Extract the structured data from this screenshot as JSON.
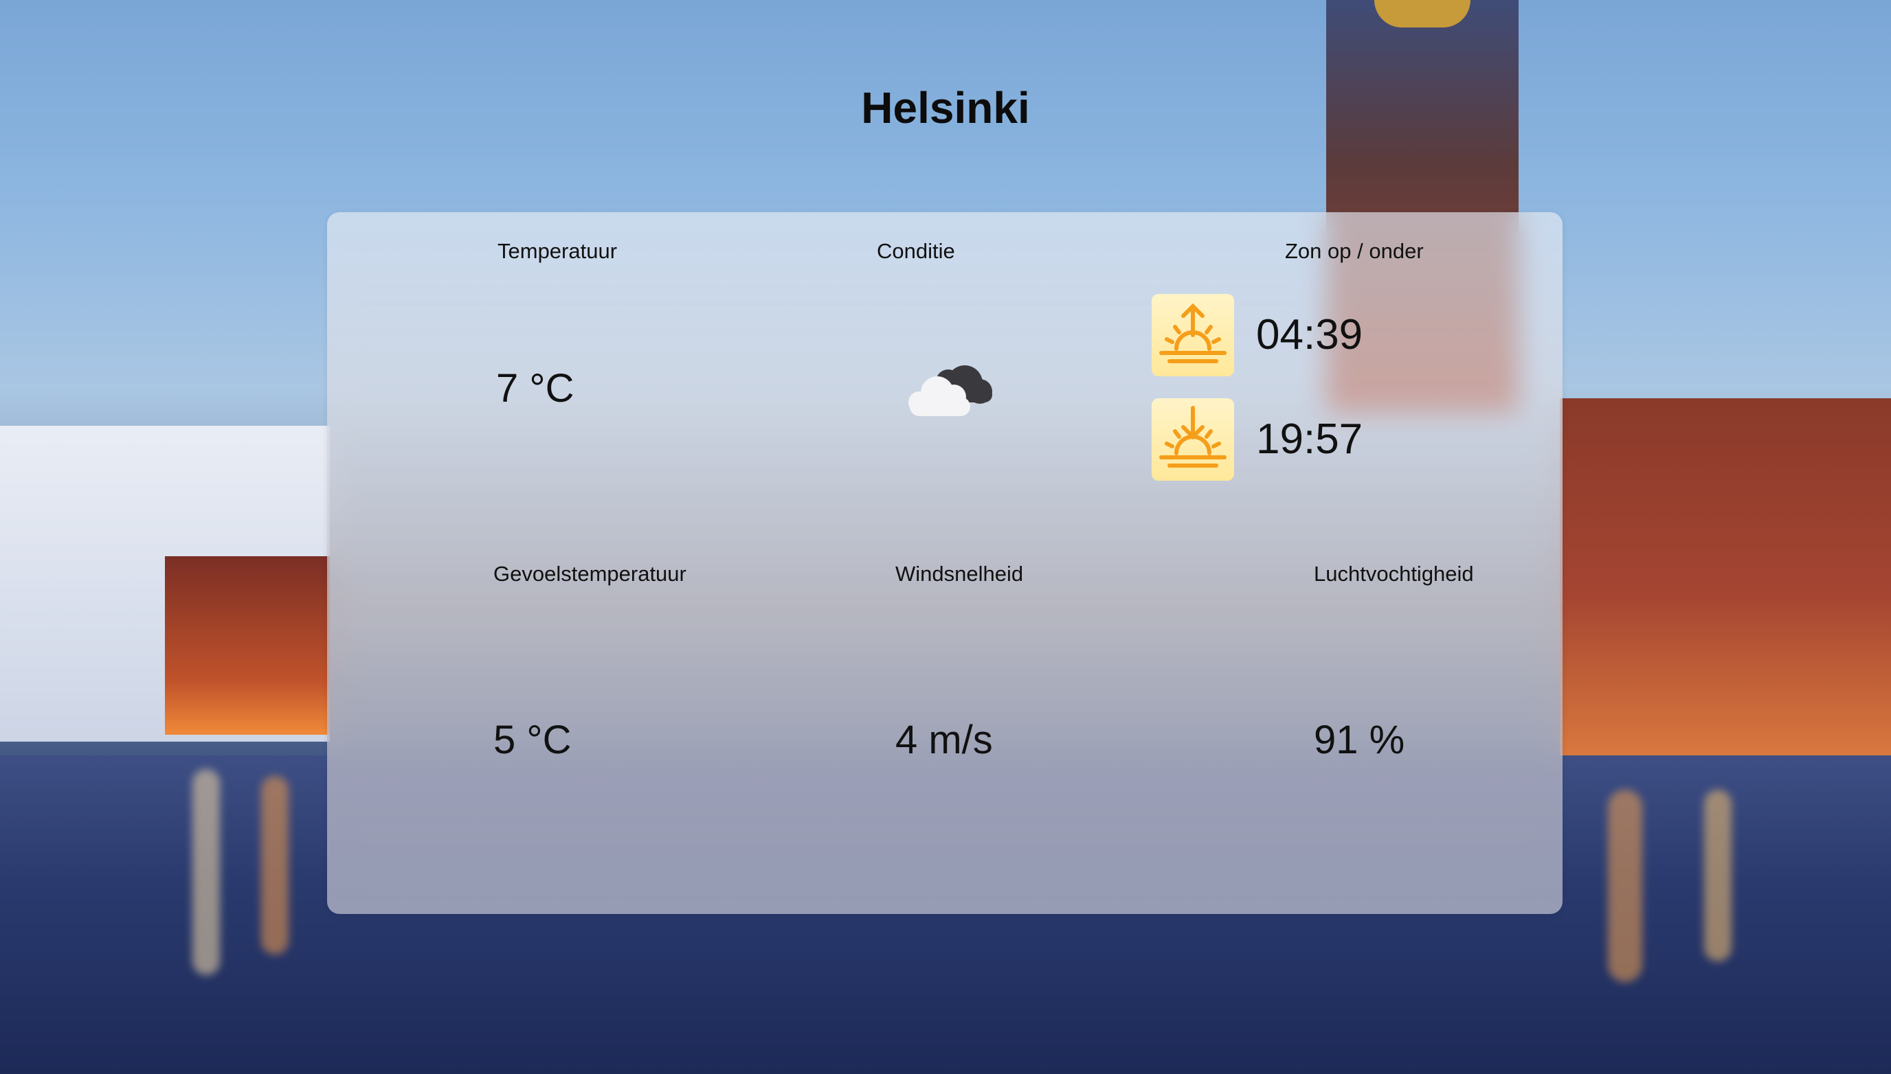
{
  "city": "Helsinki",
  "labels": {
    "temperature": "Temperatuur",
    "condition": "Conditie",
    "sun": "Zon op / onder",
    "feels_like": "Gevoelstemperatuur",
    "wind": "Windsnelheid",
    "humidity": "Luchtvochtigheid"
  },
  "values": {
    "temperature": "7 °C",
    "feels_like": "5 °C",
    "wind": "4 m/s",
    "humidity": "91 %",
    "sunrise": "04:39",
    "sunset": "19:57"
  },
  "icons": {
    "condition": "cloudy-icon",
    "sunrise": "sunrise-icon",
    "sunset": "sunset-icon"
  },
  "colors": {
    "sun_icon_orange": "#f5a623",
    "sun_tile_bg": "#ffeaa0"
  }
}
